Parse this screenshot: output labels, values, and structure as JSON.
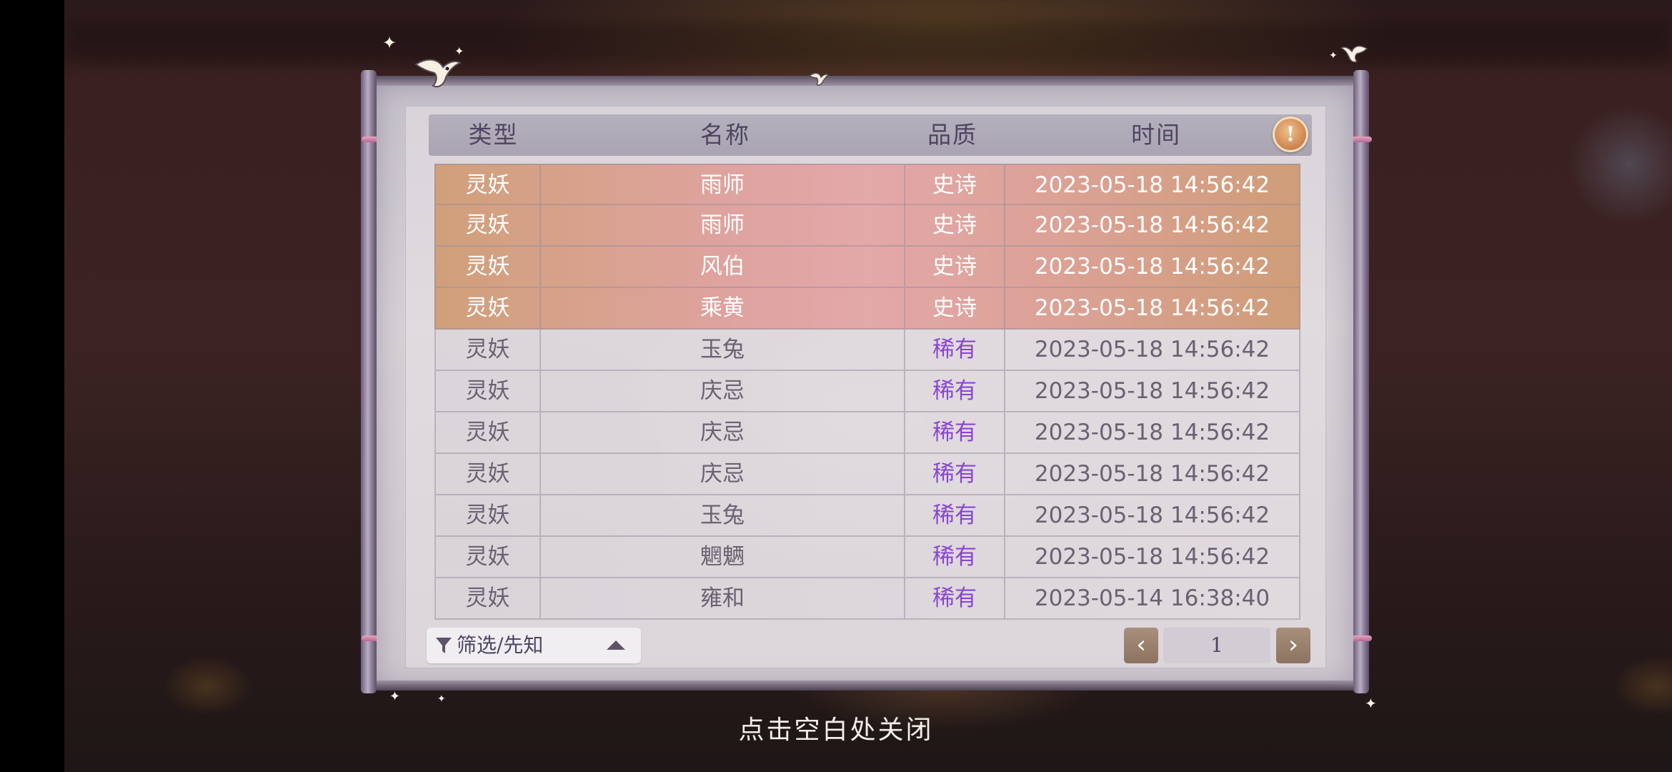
{
  "table": {
    "headers": [
      "类型",
      "名称",
      "品质",
      "时间"
    ],
    "rows": [
      {
        "type": "灵妖",
        "name": "雨师",
        "quality": "史诗",
        "time": "2023-05-18  14:56:42",
        "tier": "epic"
      },
      {
        "type": "灵妖",
        "name": "雨师",
        "quality": "史诗",
        "time": "2023-05-18  14:56:42",
        "tier": "epic"
      },
      {
        "type": "灵妖",
        "name": "风伯",
        "quality": "史诗",
        "time": "2023-05-18  14:56:42",
        "tier": "epic"
      },
      {
        "type": "灵妖",
        "name": "乘黄",
        "quality": "史诗",
        "time": "2023-05-18  14:56:42",
        "tier": "epic"
      },
      {
        "type": "灵妖",
        "name": "玉兔",
        "quality": "稀有",
        "time": "2023-05-18  14:56:42",
        "tier": "rare"
      },
      {
        "type": "灵妖",
        "name": "庆忌",
        "quality": "稀有",
        "time": "2023-05-18  14:56:42",
        "tier": "rare"
      },
      {
        "type": "灵妖",
        "name": "庆忌",
        "quality": "稀有",
        "time": "2023-05-18  14:56:42",
        "tier": "rare"
      },
      {
        "type": "灵妖",
        "name": "庆忌",
        "quality": "稀有",
        "time": "2023-05-18  14:56:42",
        "tier": "rare"
      },
      {
        "type": "灵妖",
        "name": "玉兔",
        "quality": "稀有",
        "time": "2023-05-18  14:56:42",
        "tier": "rare"
      },
      {
        "type": "灵妖",
        "name": "魍魉",
        "quality": "稀有",
        "time": "2023-05-18  14:56:42",
        "tier": "rare"
      },
      {
        "type": "灵妖",
        "name": "雍和",
        "quality": "稀有",
        "time": "2023-05-14  16:38:40",
        "tier": "rare"
      }
    ]
  },
  "hint_button": {
    "icon": "exclamation-icon",
    "symbol": "!"
  },
  "filter": {
    "label": "筛选/先知",
    "icon": "filter-icon",
    "caret_icon": "caret-up-icon"
  },
  "pagination": {
    "prev_symbol": "‹",
    "next_symbol": "›",
    "page": "1"
  },
  "close_hint": "点击空白处关闭",
  "colors": {
    "epic_row": "#dfa3a0",
    "rare_quality_text": "#8a45d2",
    "header_text": "#4f4563"
  }
}
